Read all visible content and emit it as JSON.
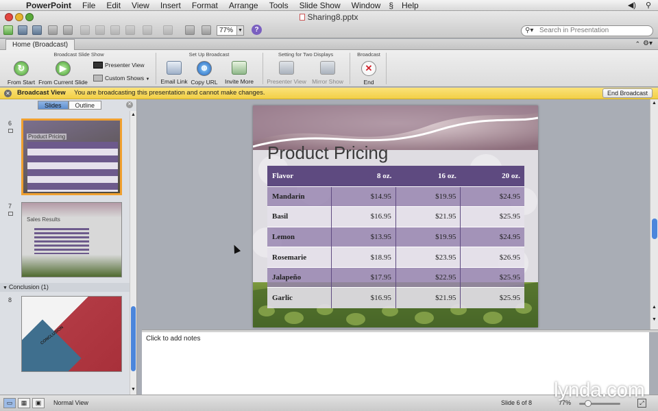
{
  "menubar": {
    "app": "PowerPoint",
    "items": [
      "File",
      "Edit",
      "View",
      "Insert",
      "Format",
      "Arrange",
      "Tools",
      "Slide Show",
      "Window",
      "Help"
    ]
  },
  "window": {
    "title": "Sharing8.pptx"
  },
  "toolbar": {
    "zoom": "77%",
    "search_placeholder": "Search in Presentation"
  },
  "ribbon": {
    "tab": "Home (Broadcast)",
    "groups": {
      "broadcast_slide_show": "Broadcast Slide Show",
      "set_up_broadcast": "Set Up Broadcast",
      "two_displays": "Setting for Two Displays",
      "broadcast": "Broadcast"
    },
    "buttons": {
      "from_start": "From Start",
      "from_current": "From Current Slide",
      "presenter_view": "Presenter View",
      "custom_shows": "Custom Shows",
      "email_link": "Email Link",
      "copy_url": "Copy URL",
      "invite_more": "Invite More",
      "presenter_view2": "Presenter View",
      "mirror_show": "Mirror Show",
      "end": "End"
    }
  },
  "broadcast_bar": {
    "title": "Broadcast View",
    "message": "You are broadcasting this presentation and cannot make changes.",
    "end_button": "End Broadcast"
  },
  "left_pane": {
    "tabs": [
      "Slides",
      "Outline"
    ],
    "section": "Conclusion (1)",
    "thumbs": [
      {
        "num": "6",
        "title": "Product Pricing"
      },
      {
        "num": "7",
        "title": "Sales Results"
      },
      {
        "num": "8",
        "title": "CONCLUSION"
      }
    ]
  },
  "slide": {
    "title": "Product Pricing",
    "headers": [
      "Flavor",
      "8 oz.",
      "16 oz.",
      "20 oz."
    ],
    "rows": [
      [
        "Mandarin",
        "$14.95",
        "$19.95",
        "$24.95"
      ],
      [
        "Basil",
        "$16.95",
        "$21.95",
        "$25.95"
      ],
      [
        "Lemon",
        "$13.95",
        "$19.95",
        "$24.95"
      ],
      [
        "Rosemarie",
        "$18.95",
        "$23.95",
        "$26.95"
      ],
      [
        "Jalapeño",
        "$17.95",
        "$22.95",
        "$25.95"
      ],
      [
        "Garlic",
        "$16.95",
        "$21.95",
        "$25.95"
      ]
    ]
  },
  "notes": {
    "placeholder": "Click to add notes"
  },
  "status": {
    "view": "Normal View",
    "slide": "Slide 6 of 8",
    "zoom": "77%"
  },
  "watermark": "lynda.com",
  "colors": {
    "table_header": "#5e4a80",
    "broadcast_bar": "#f5d455",
    "selection": "#f0a030"
  }
}
